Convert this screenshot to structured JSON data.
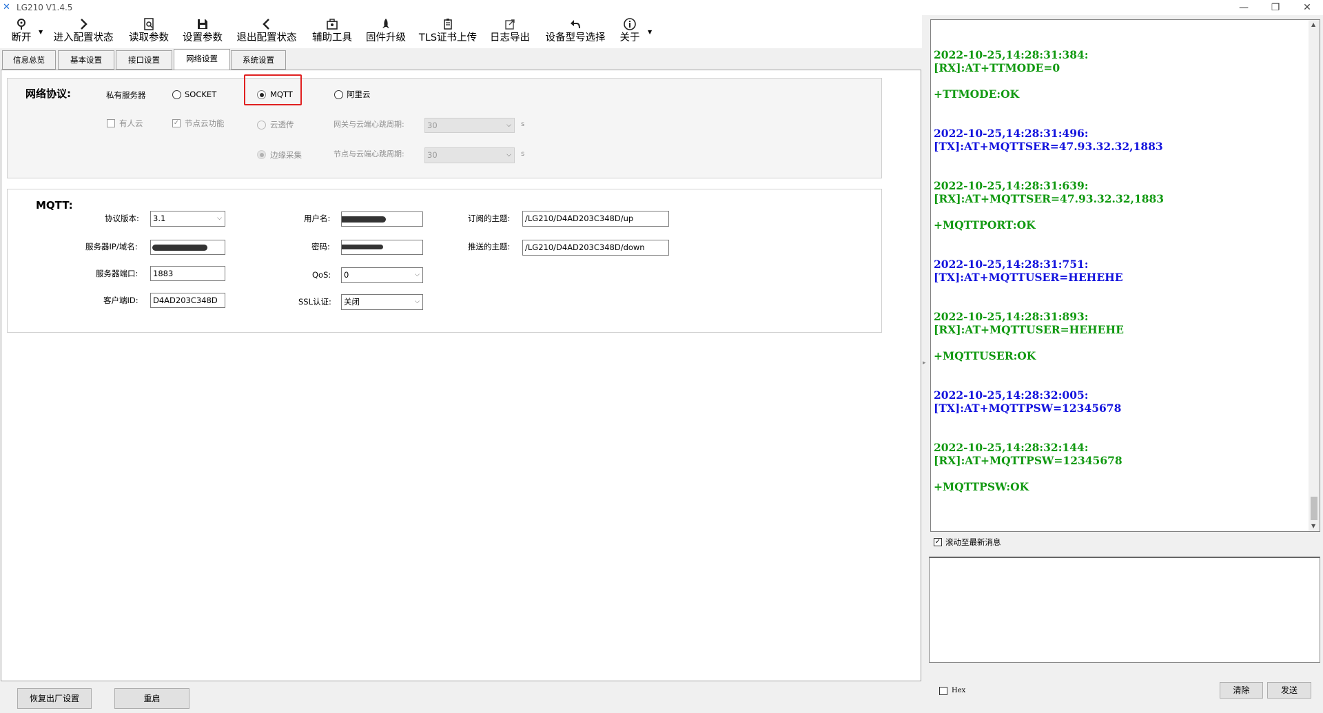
{
  "window": {
    "title": "LG210 V1.4.5",
    "minimize": "—",
    "restore": "❐",
    "close": "✕"
  },
  "toolbar": [
    {
      "label": "断开",
      "icon": "disconnect-icon"
    },
    {
      "label": "进入配置状态",
      "icon": "chevron-right-icon"
    },
    {
      "label": "读取参数",
      "icon": "read-params-icon"
    },
    {
      "label": "设置参数",
      "icon": "save-icon"
    },
    {
      "label": "退出配置状态",
      "icon": "chevron-left-icon"
    },
    {
      "label": "辅助工具",
      "icon": "toolbox-icon"
    },
    {
      "label": "固件升级",
      "icon": "rocket-icon"
    },
    {
      "label": "TLS证书上传",
      "icon": "certificate-icon"
    },
    {
      "label": "日志导出",
      "icon": "export-icon"
    },
    {
      "label": "设备型号选择",
      "icon": "undo-icon"
    },
    {
      "label": "关于",
      "icon": "info-icon"
    }
  ],
  "tabs": [
    "信息总览",
    "基本设置",
    "接口设置",
    "网络设置",
    "系统设置"
  ],
  "active_tab": "网络设置",
  "protocol": {
    "heading": "网络协议:",
    "private_server": "私有服务器",
    "socket": "SOCKET",
    "mqtt": "MQTT",
    "aliyun": "阿里云",
    "usr_cloud": "有人云",
    "node_cloud": "节点云功能",
    "cloud_transparent": "云透传",
    "edge_collect": "边缘采集",
    "gw_heartbeat_label": "网关与云端心跳周期:",
    "gw_heartbeat_value": "30",
    "node_heartbeat_label": "节点与云端心跳周期:",
    "node_heartbeat_value": "30",
    "unit": "s"
  },
  "mqtt": {
    "heading": "MQTT:",
    "version_label": "协议版本:",
    "version_value": "3.1",
    "server_label": "服务器IP/域名:",
    "port_label": "服务器端口:",
    "port_value": "1883",
    "client_id_label": "客户端ID:",
    "client_id_value": "D4AD203C348D",
    "user_label": "用户名:",
    "password_label": "密码:",
    "qos_label": "QoS:",
    "qos_value": "0",
    "ssl_label": "SSL认证:",
    "ssl_value": "关闭",
    "sub_label": "订阅的主题:",
    "sub_value": "/LG210/D4AD203C348D/up",
    "pub_label": "推送的主题:",
    "pub_value": "/LG210/D4AD203C348D/down"
  },
  "bottom": {
    "factory_reset": "恢复出厂设置",
    "restart": "重启"
  },
  "log": [
    {
      "text": "2022-10-25,14:28:31:384:",
      "kind": "rx"
    },
    {
      "text": "[RX]:AT+TTMODE=0",
      "kind": "rx"
    },
    {
      "text": "+TTMODE:OK",
      "kind": "rx"
    },
    {
      "text": "2022-10-25,14:28:31:496:",
      "kind": "tx"
    },
    {
      "text": "[TX]:AT+MQTTSER=47.93.32.32,1883",
      "kind": "tx"
    },
    {
      "text": "2022-10-25,14:28:31:639:",
      "kind": "rx"
    },
    {
      "text": "[RX]:AT+MQTTSER=47.93.32.32,1883",
      "kind": "rx"
    },
    {
      "text": "+MQTTPORT:OK",
      "kind": "rx"
    },
    {
      "text": "2022-10-25,14:28:31:751:",
      "kind": "tx"
    },
    {
      "text": "[TX]:AT+MQTTUSER=HEHEHE",
      "kind": "tx"
    },
    {
      "text": "2022-10-25,14:28:31:893:",
      "kind": "rx"
    },
    {
      "text": "[RX]:AT+MQTTUSER=HEHEHE",
      "kind": "rx"
    },
    {
      "text": "+MQTTUSER:OK",
      "kind": "rx"
    },
    {
      "text": "2022-10-25,14:28:32:005:",
      "kind": "tx"
    },
    {
      "text": "[TX]:AT+MQTTPSW=12345678",
      "kind": "tx"
    },
    {
      "text": "2022-10-25,14:28:32:144:",
      "kind": "rx"
    },
    {
      "text": "[RX]:AT+MQTTPSW=12345678",
      "kind": "rx"
    },
    {
      "text": "+MQTTPSW:OK",
      "kind": "rx"
    }
  ],
  "scroll_latest": "滚动至最新消息",
  "hex": "Hex",
  "clear": "清除",
  "send": "发送",
  "colors": {
    "rx": "#119911",
    "tx": "#1414dd",
    "highlight": "#e02020"
  }
}
